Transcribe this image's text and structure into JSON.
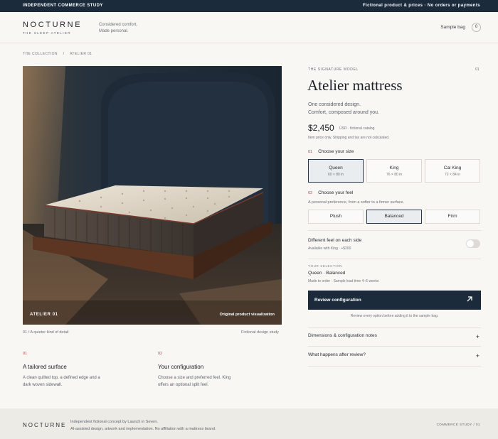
{
  "topbar": {
    "left": "INDEPENDENT COMMERCE STUDY",
    "right": "Fictional product & prices · No orders or payments"
  },
  "header": {
    "logo": "NOCTURNE",
    "logo_sub": "THE SLEEP ATELIER",
    "tagline_1": "Considered comfort.",
    "tagline_2": "Made personal.",
    "bag_label": "Sample bag",
    "bag_count": "0"
  },
  "breadcrumb": {
    "items": [
      "THE COLLECTION",
      "/",
      "ATELIER 01"
    ]
  },
  "hero": {
    "label_left": "ATELIER 01",
    "label_right": "Original product visualization",
    "caption_left": "01 / A quieter kind of detail",
    "caption_right": "Fictional design study"
  },
  "features": [
    {
      "num": "01",
      "title": "A tailored surface",
      "desc_1": "A clean quilted top, a defined edge and a",
      "desc_2": "dark woven sidewall."
    },
    {
      "num": "02",
      "title": "Your configuration",
      "desc_1": "Choose a size and preferred feel. King",
      "desc_2": "offers an optional split feel."
    }
  ],
  "product": {
    "kicker": "THE SIGNATURE MODEL",
    "kicker_num": "01",
    "title": "Atelier mattress",
    "subtitle_1": "One considered design.",
    "subtitle_2": "Comfort, composed around you.",
    "price": "$2,450",
    "price_note": "USD · fictional catalog",
    "price_sub": "Item price only. Shipping and tax are not calculated."
  },
  "size": {
    "num": "01",
    "heading": "Choose your size",
    "options": [
      {
        "name": "Queen",
        "dims": "60 × 80 in",
        "selected": true
      },
      {
        "name": "King",
        "dims": "76 × 80 in",
        "selected": false
      },
      {
        "name": "Cal King",
        "dims": "72 × 84 in",
        "selected": false
      }
    ]
  },
  "feel": {
    "num": "02",
    "heading": "Choose your feel",
    "desc": "A personal preference, from a softer to a firmer surface.",
    "options": [
      {
        "name": "Plush",
        "selected": false
      },
      {
        "name": "Balanced",
        "selected": true
      },
      {
        "name": "Firm",
        "selected": false
      }
    ]
  },
  "split": {
    "title": "Different feel on each side",
    "sub": "Available with King · +$200",
    "enabled": false
  },
  "selection": {
    "label": "YOUR SELECTION",
    "value": "Queen · Balanced",
    "sub": "Made to order · Sample lead time 4–6 weeks"
  },
  "cta": {
    "label": "Review configuration",
    "icon": "arrow-up-right-icon",
    "note": "Review every option before adding it to the sample bag."
  },
  "accordion": [
    {
      "label": "Dimensions & configuration notes",
      "icon": "+"
    },
    {
      "label": "What happens after review?",
      "icon": "+"
    }
  ],
  "footer": {
    "logo": "NOCTURNE",
    "line_1": "Independent fictional concept by Launch in Seven.",
    "line_2": "AI-assisted design, artwork and implementation. No affiliation with a mattress brand.",
    "right": "COMMERCE STUDY / 01"
  },
  "colors": {
    "accent": "#1b2b3c",
    "number_red": "#b04a4a",
    "background": "#f8f7f4"
  }
}
